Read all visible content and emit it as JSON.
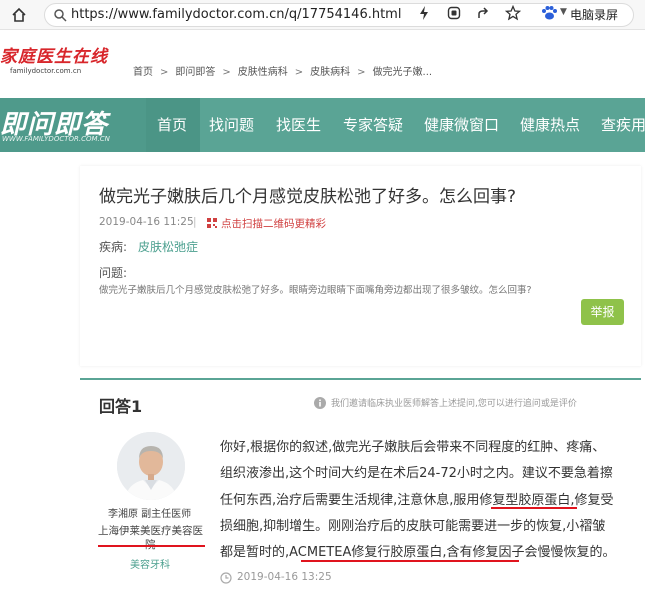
{
  "browser": {
    "url": "https://www.familydoctor.com.cn/q/17754146.html",
    "profile_label": "电脑录屏"
  },
  "site": {
    "logo_text": "家庭医生在线",
    "logo_sub": "familydoctor.com.cn",
    "brand_nav_text": "即问即答",
    "brand_nav_sub": "WWW.FAMILYDOCTOR.COM.CN"
  },
  "breadcrumb": [
    "首页",
    "即问即答",
    "皮肤性病科",
    "皮肤病科",
    "做完光子嫩..."
  ],
  "nav": {
    "items": [
      "首页",
      "找问题",
      "找医生",
      "专家答疑",
      "健康微窗口",
      "健康热点",
      "查疾用"
    ],
    "active_index": 0,
    "accent_color": "#5aa495"
  },
  "question": {
    "title": "做完光子嫩肤后几个月感觉皮肤松弛了好多。怎么回事?",
    "date": "2019-04-16 11:25",
    "qr_text": "点击扫描二维码更精彩",
    "disease_label": "疾病:",
    "disease_value": "皮肤松弛症",
    "question_label": "问题:",
    "question_text": "做完光子嫩肤后几个月感觉皮肤松弛了好多。眼睛旁边眼睛下面嘴角旁边都出现了很多皱纹。怎么回事?",
    "report_label": "举报"
  },
  "answer": {
    "title": "回答1",
    "note": "我们邀请临床执业医师解答上述提问,您可以进行追问或是评价",
    "doctor_name": "李湘原 副主任医师",
    "doctor_hospital_line1": "上海伊莱美医疗美容医",
    "doctor_hospital_line2": "院",
    "doctor_department": "美容牙科",
    "lines": [
      "你好,根据你的叙述,做完光子嫩肤后会带来不同程度的红肿、疼痛、",
      "组织液渗出,这个时间大约是在术后24-72小时之内。建议不要急着擦",
      "任何东西,治疗后需要生活规律,注意休息,服用修复型胶原蛋白,修复受",
      "损细胞,抑制增生。刚刚治疗后的皮肤可能需要进一步的恢复,小褶皱",
      "都是暂时的,ACMETEA修复行胶原蛋白,含有修复因子会慢慢恢复的。"
    ],
    "time": "2019-04-16 13:25"
  }
}
